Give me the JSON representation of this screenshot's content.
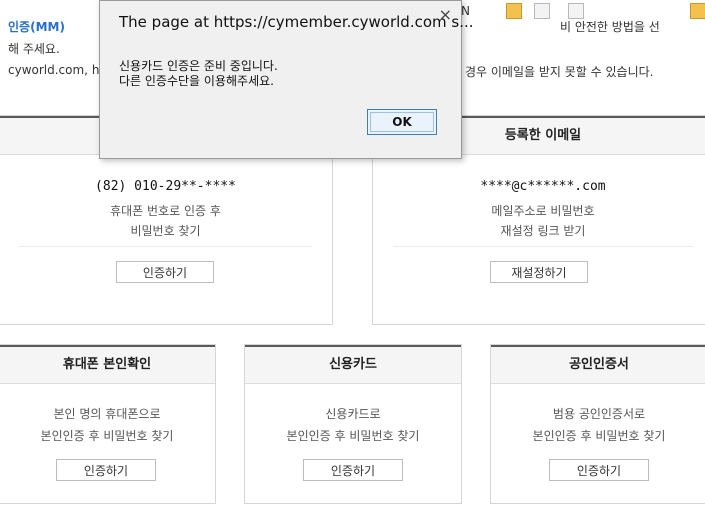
{
  "background": {
    "line1_left": "인증(MM)",
    "line1_right": "비 안전한 방법을 선",
    "line2": "해 주세요.",
    "line3_left": "cyworld.com, ha",
    "line3_right": "경우 이메일을 받지 못할 수 있습니다."
  },
  "toolbar": {
    "n_label": "N"
  },
  "dialog": {
    "title": "The page at https://cymember.cyworld.com s...",
    "close": "×",
    "message_line1": "신용카드 인증은 준비 중입니다.",
    "message_line2": "다른 인증수단을 이용해주세요.",
    "ok_label": "OK"
  },
  "cards_top": [
    {
      "title": "",
      "strong": "(82) 010-29**-****",
      "line1": "휴대폰 번호로 인증 후",
      "line2": "비밀번호 찾기",
      "button": "인증하기"
    },
    {
      "title": "등록한 이메일",
      "strong": "****@c******.com",
      "line1": "메일주소로 비밀번호",
      "line2": "재설정 링크 받기",
      "button": "재설정하기"
    }
  ],
  "cards_bottom": [
    {
      "title": "휴대폰 본인확인",
      "line1": "본인 명의 휴대폰으로",
      "line2": "본인인증 후 비밀번호 찾기",
      "button": "인증하기"
    },
    {
      "title": "신용카드",
      "line1": "신용카드로",
      "line2": "본인인증 후 비밀번호 찾기",
      "button": "인증하기"
    },
    {
      "title": "공인인증서",
      "line1": "범용 공인인증서로",
      "line2": "본인인증 후 비밀번호 찾기",
      "button": "인증하기"
    }
  ]
}
